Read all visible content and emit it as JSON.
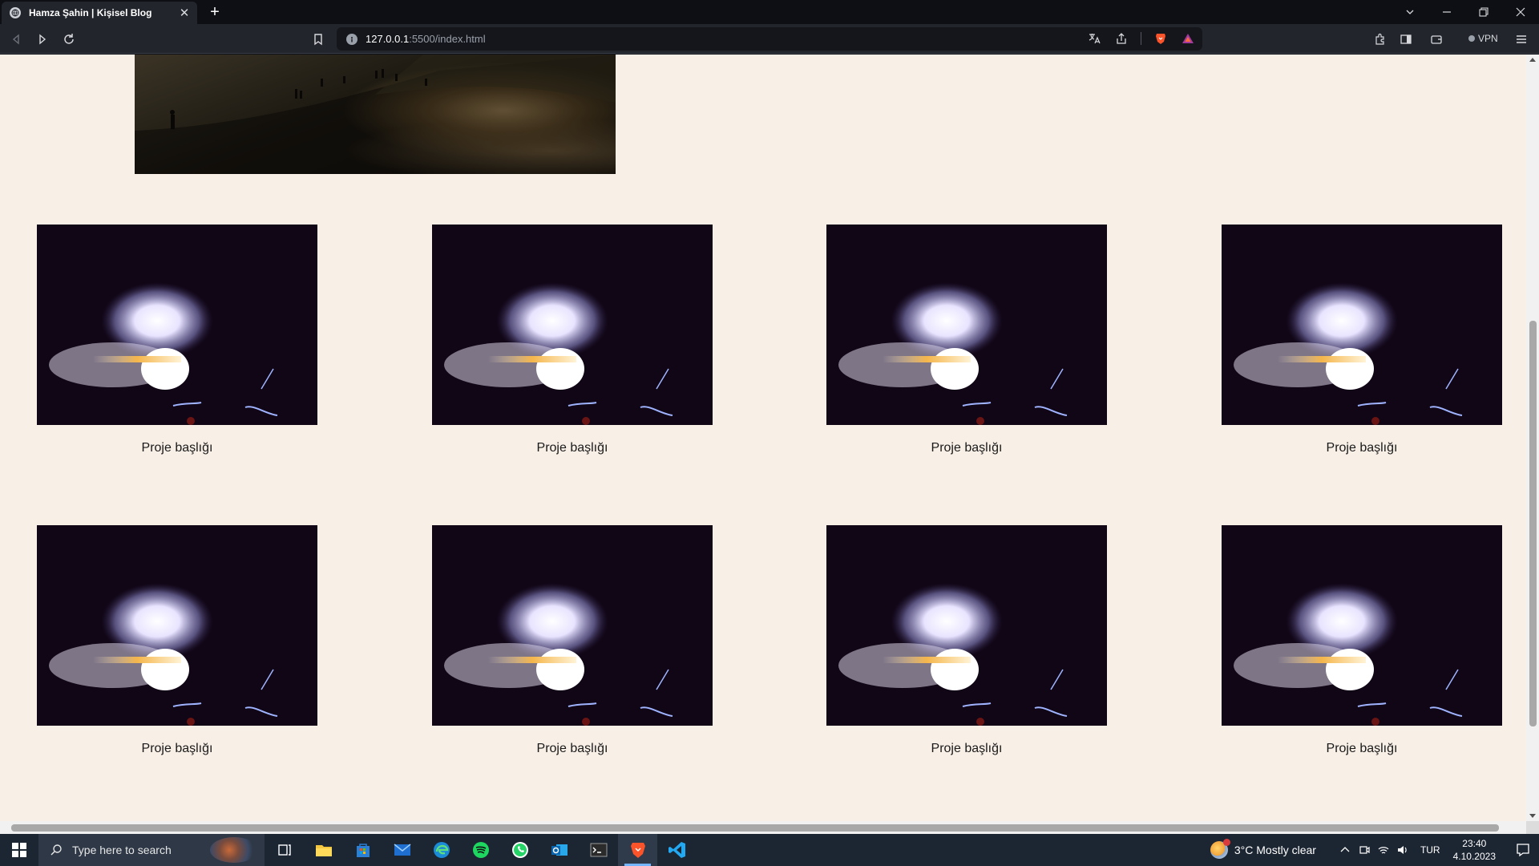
{
  "browser": {
    "tab_title": "Hamza Şahin | Kişisel Blog",
    "url_host": "127.0.0.1",
    "url_rest": ":5500/index.html",
    "vpn_label": "VPN",
    "icons": {
      "tab_favicon": "globe-icon",
      "tab_close": "close-icon",
      "new_tab": "plus-icon",
      "back": "back-arrow-icon",
      "forward": "forward-arrow-icon",
      "reload": "reload-icon",
      "bookmark": "bookmark-icon",
      "site_info": "info-icon",
      "translate": "translate-icon",
      "share": "share-icon",
      "brave_shield": "brave-lion-icon",
      "brave_rewards": "rewards-triangle-icon",
      "extensions": "puzzle-icon",
      "sidebar": "sidebar-icon",
      "wallet": "wallet-icon",
      "menu": "hamburger-icon"
    }
  },
  "page": {
    "background": "#f8efe6",
    "projects": [
      {
        "title": "Proje başlığı"
      },
      {
        "title": "Proje başlığı"
      },
      {
        "title": "Proje başlığı"
      },
      {
        "title": "Proje başlığı"
      },
      {
        "title": "Proje başlığı"
      },
      {
        "title": "Proje başlığı"
      },
      {
        "title": "Proje başlığı"
      },
      {
        "title": "Proje başlığı"
      }
    ]
  },
  "taskbar": {
    "search_placeholder": "Type here to search",
    "apps": [
      "task-view-icon",
      "file-explorer-icon",
      "microsoft-store-icon",
      "mail-icon",
      "edge-icon",
      "spotify-icon",
      "whatsapp-icon",
      "outlook-icon",
      "terminal-icon",
      "brave-icon",
      "vscode-icon"
    ],
    "weather": "3°C  Mostly clear",
    "language": "TUR",
    "time": "23:40",
    "date": "4.10.2023"
  }
}
